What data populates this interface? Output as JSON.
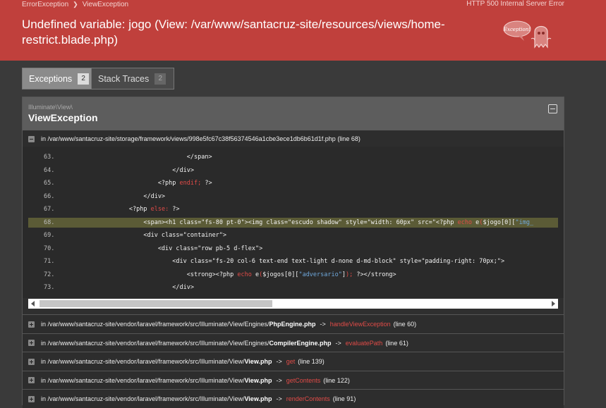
{
  "breadcrumbs": [
    "ErrorException",
    "ViewException"
  ],
  "http_status": "HTTP 500 Internal Server Error",
  "message": "Undefined variable: jogo (View: /var/www/santacruz-site/resources/views/home-restrict.blade.php)",
  "mascot": {
    "label": "Exception!",
    "icon": "ghost-icon"
  },
  "tabs": [
    {
      "label": "Exceptions",
      "count": "2",
      "active": true
    },
    {
      "label": "Stack Traces",
      "count": "2",
      "active": false
    }
  ],
  "exception": {
    "namespace": "Illuminate\\View\\",
    "class": "ViewException",
    "frame": {
      "prefix": "in",
      "file": "/var/www/santacruz-site/storage/framework/views/998e5fc67c38f56374546a1cbe3ece1db6b61d1f.php",
      "line": "(line 68)"
    }
  },
  "code_lines": [
    {
      "num": "63.",
      "text": "                                </span>"
    },
    {
      "num": "64.",
      "text": "                            </div>"
    },
    {
      "num": "65.",
      "text": "                        <?php endif; ?>"
    },
    {
      "num": "66.",
      "text": "                    </div>"
    },
    {
      "num": "67.",
      "text": "                <?php else: ?>"
    },
    {
      "num": "68.",
      "text": "                    <span><h1 class=\"fs-80 pt-0\"><img class=\"escudo shadow\" style=\"width: 60px\" src=\"<?php echo e($jogo[0][\"img_",
      "highlight": true
    },
    {
      "num": "69.",
      "text": "                    <div class=\"container\">"
    },
    {
      "num": "70.",
      "text": "                        <div class=\"row pb-5 d-flex\">"
    },
    {
      "num": "71.",
      "text": "                            <div class=\"fs-20 col-6 text-end text-light d-none d-md-block\" style=\"padding-right: 70px;\">"
    },
    {
      "num": "72.",
      "text": "                                <strong><?php echo e($jogos[0][\"adversario\"]); ?></strong>"
    },
    {
      "num": "73.",
      "text": "                            </div>"
    }
  ],
  "frames": [
    {
      "dir": "/var/www/santacruz-site/vendor/laravel/framework/src/Illuminate/View/Engines/",
      "file": "PhpEngine.php",
      "method": "handleViewException",
      "line": "(line 60)"
    },
    {
      "dir": "/var/www/santacruz-site/vendor/laravel/framework/src/Illuminate/View/Engines/",
      "file": "CompilerEngine.php",
      "method": "evaluatePath",
      "line": "(line 61)"
    },
    {
      "dir": "/var/www/santacruz-site/vendor/laravel/framework/src/Illuminate/View/",
      "file": "View.php",
      "method": "get",
      "line": "(line 139)"
    },
    {
      "dir": "/var/www/santacruz-site/vendor/laravel/framework/src/Illuminate/View/",
      "file": "View.php",
      "method": "getContents",
      "line": "(line 122)"
    },
    {
      "dir": "/var/www/santacruz-site/vendor/laravel/framework/src/Illuminate/View/",
      "file": "View.php",
      "method": "renderContents",
      "line": "(line 91)"
    }
  ],
  "frame_prefix": "in",
  "frame_arrow": "->"
}
